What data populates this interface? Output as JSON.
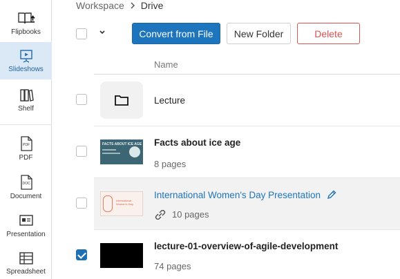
{
  "sidebar": {
    "items": [
      {
        "label": "Flipbooks",
        "icon": "book-upload-icon"
      },
      {
        "label": "Slideshows",
        "icon": "slideshow-icon"
      },
      {
        "label": "Shelf",
        "icon": "shelf-icon"
      },
      {
        "label": "PDF",
        "icon": "pdf-file-icon"
      },
      {
        "label": "Document",
        "icon": "doc-file-icon"
      },
      {
        "label": "Presentation",
        "icon": "presentation-icon"
      },
      {
        "label": "Spreadsheet",
        "icon": "spreadsheet-icon"
      }
    ],
    "active": "Slideshows",
    "accent": "#dbe9f7"
  },
  "breadcrumb": {
    "root": "Workspace",
    "current": "Drive"
  },
  "toolbar": {
    "convert_label": "Convert from File",
    "new_folder_label": "New Folder",
    "delete_label": "Delete"
  },
  "table": {
    "name_header": "Name"
  },
  "rows": [
    {
      "name": "Lecture",
      "meta": "",
      "type": "folder",
      "checked": false
    },
    {
      "name": "Facts about ice age",
      "meta": "8 pages",
      "type": "slideshow",
      "thumb_title": "FACTS ABOUT ICE AGE",
      "checked": false
    },
    {
      "name": "International Women's Day Presentation",
      "meta": "10 pages",
      "type": "slideshow",
      "thumb_title": "International Women's Day",
      "shared": true,
      "checked": false
    },
    {
      "name": "lecture-01-overview-of-agile-development",
      "meta": "74 pages",
      "type": "slideshow",
      "checked": true
    }
  ],
  "colors": {
    "primary": "#1d75bd",
    "danger": "#d9534f",
    "link": "#1d75bd"
  }
}
